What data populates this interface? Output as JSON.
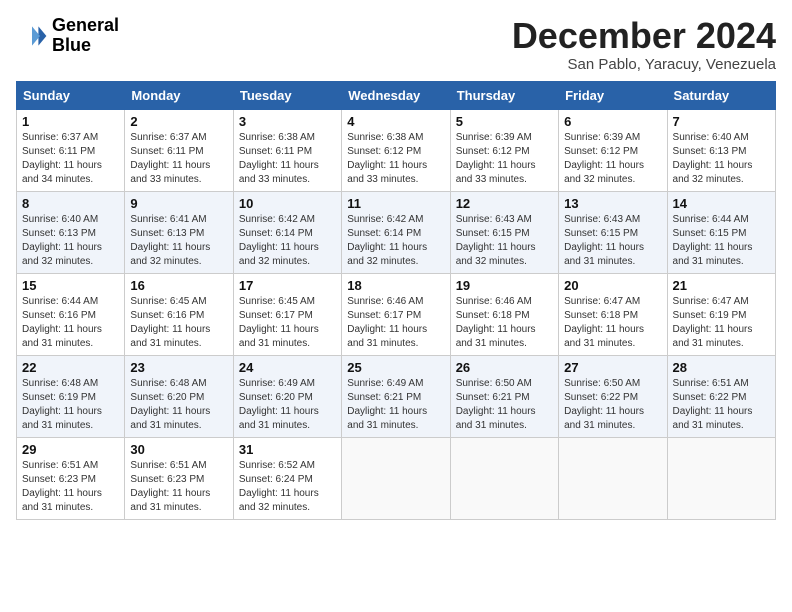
{
  "header": {
    "logo_line1": "General",
    "logo_line2": "Blue",
    "title": "December 2024",
    "location": "San Pablo, Yaracuy, Venezuela"
  },
  "weekdays": [
    "Sunday",
    "Monday",
    "Tuesday",
    "Wednesday",
    "Thursday",
    "Friday",
    "Saturday"
  ],
  "weeks": [
    [
      {
        "day": "1",
        "sunrise": "6:37 AM",
        "sunset": "6:11 PM",
        "daylight": "11 hours and 34 minutes."
      },
      {
        "day": "2",
        "sunrise": "6:37 AM",
        "sunset": "6:11 PM",
        "daylight": "11 hours and 33 minutes."
      },
      {
        "day": "3",
        "sunrise": "6:38 AM",
        "sunset": "6:11 PM",
        "daylight": "11 hours and 33 minutes."
      },
      {
        "day": "4",
        "sunrise": "6:38 AM",
        "sunset": "6:12 PM",
        "daylight": "11 hours and 33 minutes."
      },
      {
        "day": "5",
        "sunrise": "6:39 AM",
        "sunset": "6:12 PM",
        "daylight": "11 hours and 33 minutes."
      },
      {
        "day": "6",
        "sunrise": "6:39 AM",
        "sunset": "6:12 PM",
        "daylight": "11 hours and 32 minutes."
      },
      {
        "day": "7",
        "sunrise": "6:40 AM",
        "sunset": "6:13 PM",
        "daylight": "11 hours and 32 minutes."
      }
    ],
    [
      {
        "day": "8",
        "sunrise": "6:40 AM",
        "sunset": "6:13 PM",
        "daylight": "11 hours and 32 minutes."
      },
      {
        "day": "9",
        "sunrise": "6:41 AM",
        "sunset": "6:13 PM",
        "daylight": "11 hours and 32 minutes."
      },
      {
        "day": "10",
        "sunrise": "6:42 AM",
        "sunset": "6:14 PM",
        "daylight": "11 hours and 32 minutes."
      },
      {
        "day": "11",
        "sunrise": "6:42 AM",
        "sunset": "6:14 PM",
        "daylight": "11 hours and 32 minutes."
      },
      {
        "day": "12",
        "sunrise": "6:43 AM",
        "sunset": "6:15 PM",
        "daylight": "11 hours and 32 minutes."
      },
      {
        "day": "13",
        "sunrise": "6:43 AM",
        "sunset": "6:15 PM",
        "daylight": "11 hours and 31 minutes."
      },
      {
        "day": "14",
        "sunrise": "6:44 AM",
        "sunset": "6:15 PM",
        "daylight": "11 hours and 31 minutes."
      }
    ],
    [
      {
        "day": "15",
        "sunrise": "6:44 AM",
        "sunset": "6:16 PM",
        "daylight": "11 hours and 31 minutes."
      },
      {
        "day": "16",
        "sunrise": "6:45 AM",
        "sunset": "6:16 PM",
        "daylight": "11 hours and 31 minutes."
      },
      {
        "day": "17",
        "sunrise": "6:45 AM",
        "sunset": "6:17 PM",
        "daylight": "11 hours and 31 minutes."
      },
      {
        "day": "18",
        "sunrise": "6:46 AM",
        "sunset": "6:17 PM",
        "daylight": "11 hours and 31 minutes."
      },
      {
        "day": "19",
        "sunrise": "6:46 AM",
        "sunset": "6:18 PM",
        "daylight": "11 hours and 31 minutes."
      },
      {
        "day": "20",
        "sunrise": "6:47 AM",
        "sunset": "6:18 PM",
        "daylight": "11 hours and 31 minutes."
      },
      {
        "day": "21",
        "sunrise": "6:47 AM",
        "sunset": "6:19 PM",
        "daylight": "11 hours and 31 minutes."
      }
    ],
    [
      {
        "day": "22",
        "sunrise": "6:48 AM",
        "sunset": "6:19 PM",
        "daylight": "11 hours and 31 minutes."
      },
      {
        "day": "23",
        "sunrise": "6:48 AM",
        "sunset": "6:20 PM",
        "daylight": "11 hours and 31 minutes."
      },
      {
        "day": "24",
        "sunrise": "6:49 AM",
        "sunset": "6:20 PM",
        "daylight": "11 hours and 31 minutes."
      },
      {
        "day": "25",
        "sunrise": "6:49 AM",
        "sunset": "6:21 PM",
        "daylight": "11 hours and 31 minutes."
      },
      {
        "day": "26",
        "sunrise": "6:50 AM",
        "sunset": "6:21 PM",
        "daylight": "11 hours and 31 minutes."
      },
      {
        "day": "27",
        "sunrise": "6:50 AM",
        "sunset": "6:22 PM",
        "daylight": "11 hours and 31 minutes."
      },
      {
        "day": "28",
        "sunrise": "6:51 AM",
        "sunset": "6:22 PM",
        "daylight": "11 hours and 31 minutes."
      }
    ],
    [
      {
        "day": "29",
        "sunrise": "6:51 AM",
        "sunset": "6:23 PM",
        "daylight": "11 hours and 31 minutes."
      },
      {
        "day": "30",
        "sunrise": "6:51 AM",
        "sunset": "6:23 PM",
        "daylight": "11 hours and 31 minutes."
      },
      {
        "day": "31",
        "sunrise": "6:52 AM",
        "sunset": "6:24 PM",
        "daylight": "11 hours and 32 minutes."
      },
      null,
      null,
      null,
      null
    ]
  ]
}
